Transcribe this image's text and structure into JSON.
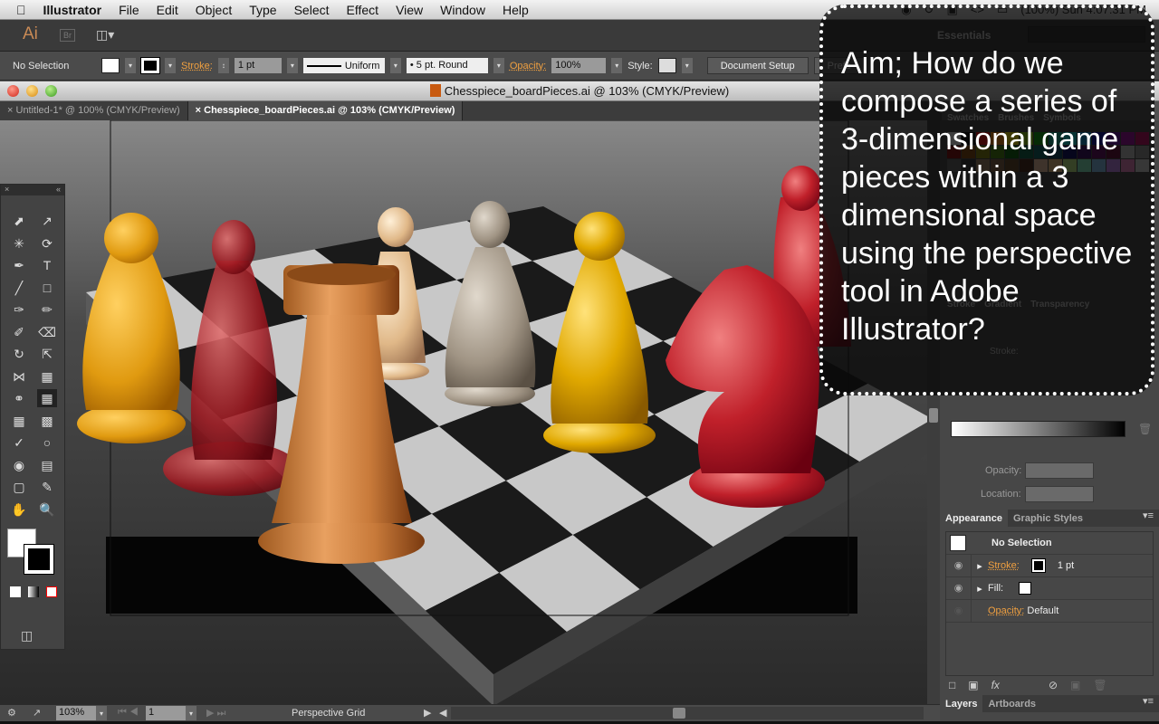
{
  "menubar": {
    "apple": "",
    "items": [
      "Illustrator",
      "File",
      "Edit",
      "Object",
      "Type",
      "Select",
      "Effect",
      "View",
      "Window",
      "Help"
    ],
    "status_right": "(100%)  Sun 4:07:31 PM"
  },
  "appbar": {
    "logo": "Ai",
    "bridge": "Br",
    "workspace": "Essentials"
  },
  "control": {
    "selection": "No Selection",
    "stroke_label": "Stroke:",
    "stroke_value": "1 pt",
    "profile": "Uniform",
    "brush": "5 pt. Round",
    "opacity_label": "Opacity:",
    "opacity_value": "100%",
    "style_label": "Style:",
    "document_setup": "Document Setup",
    "preferences": "Prefe"
  },
  "window": {
    "title": "Chesspiece_boardPieces.ai @ 103% (CMYK/Preview)"
  },
  "tabs": [
    {
      "label": "Untitled-1* @ 100% (CMYK/Preview)",
      "active": false
    },
    {
      "label": "Chesspiece_boardPieces.ai @ 103% (CMYK/Preview)",
      "active": true
    }
  ],
  "status": {
    "zoom": "103%",
    "artboard": "1",
    "tool": "Perspective Grid"
  },
  "panels_behind": {
    "tabs1": [
      "Swatches",
      "Brushes",
      "Symbols"
    ],
    "tabs2": [
      "Stroke",
      "Gradient",
      "Transparency"
    ],
    "stroke_label": "Stroke:"
  },
  "gradient_panel": {
    "opacity_label": "Opacity:",
    "location_label": "Location:"
  },
  "appearance": {
    "tabs": [
      "Appearance",
      "Graphic Styles"
    ],
    "header": "No Selection",
    "stroke_label": "Stroke:",
    "stroke_value": "1 pt",
    "fill_label": "Fill:",
    "opacity_label": "Opacity:",
    "opacity_value": "Default",
    "fx": "fx"
  },
  "layers": {
    "tabs": [
      "Layers",
      "Artboards"
    ]
  },
  "callout": {
    "text": "Aim; How do we compose a series of 3-dimensional game pieces within a 3 dimensional space using the perspective tool in Adobe Illustrator?"
  },
  "colors": {
    "accent_orange": "#f0a040",
    "panel": "#474747",
    "callout_bg": "#080808"
  }
}
